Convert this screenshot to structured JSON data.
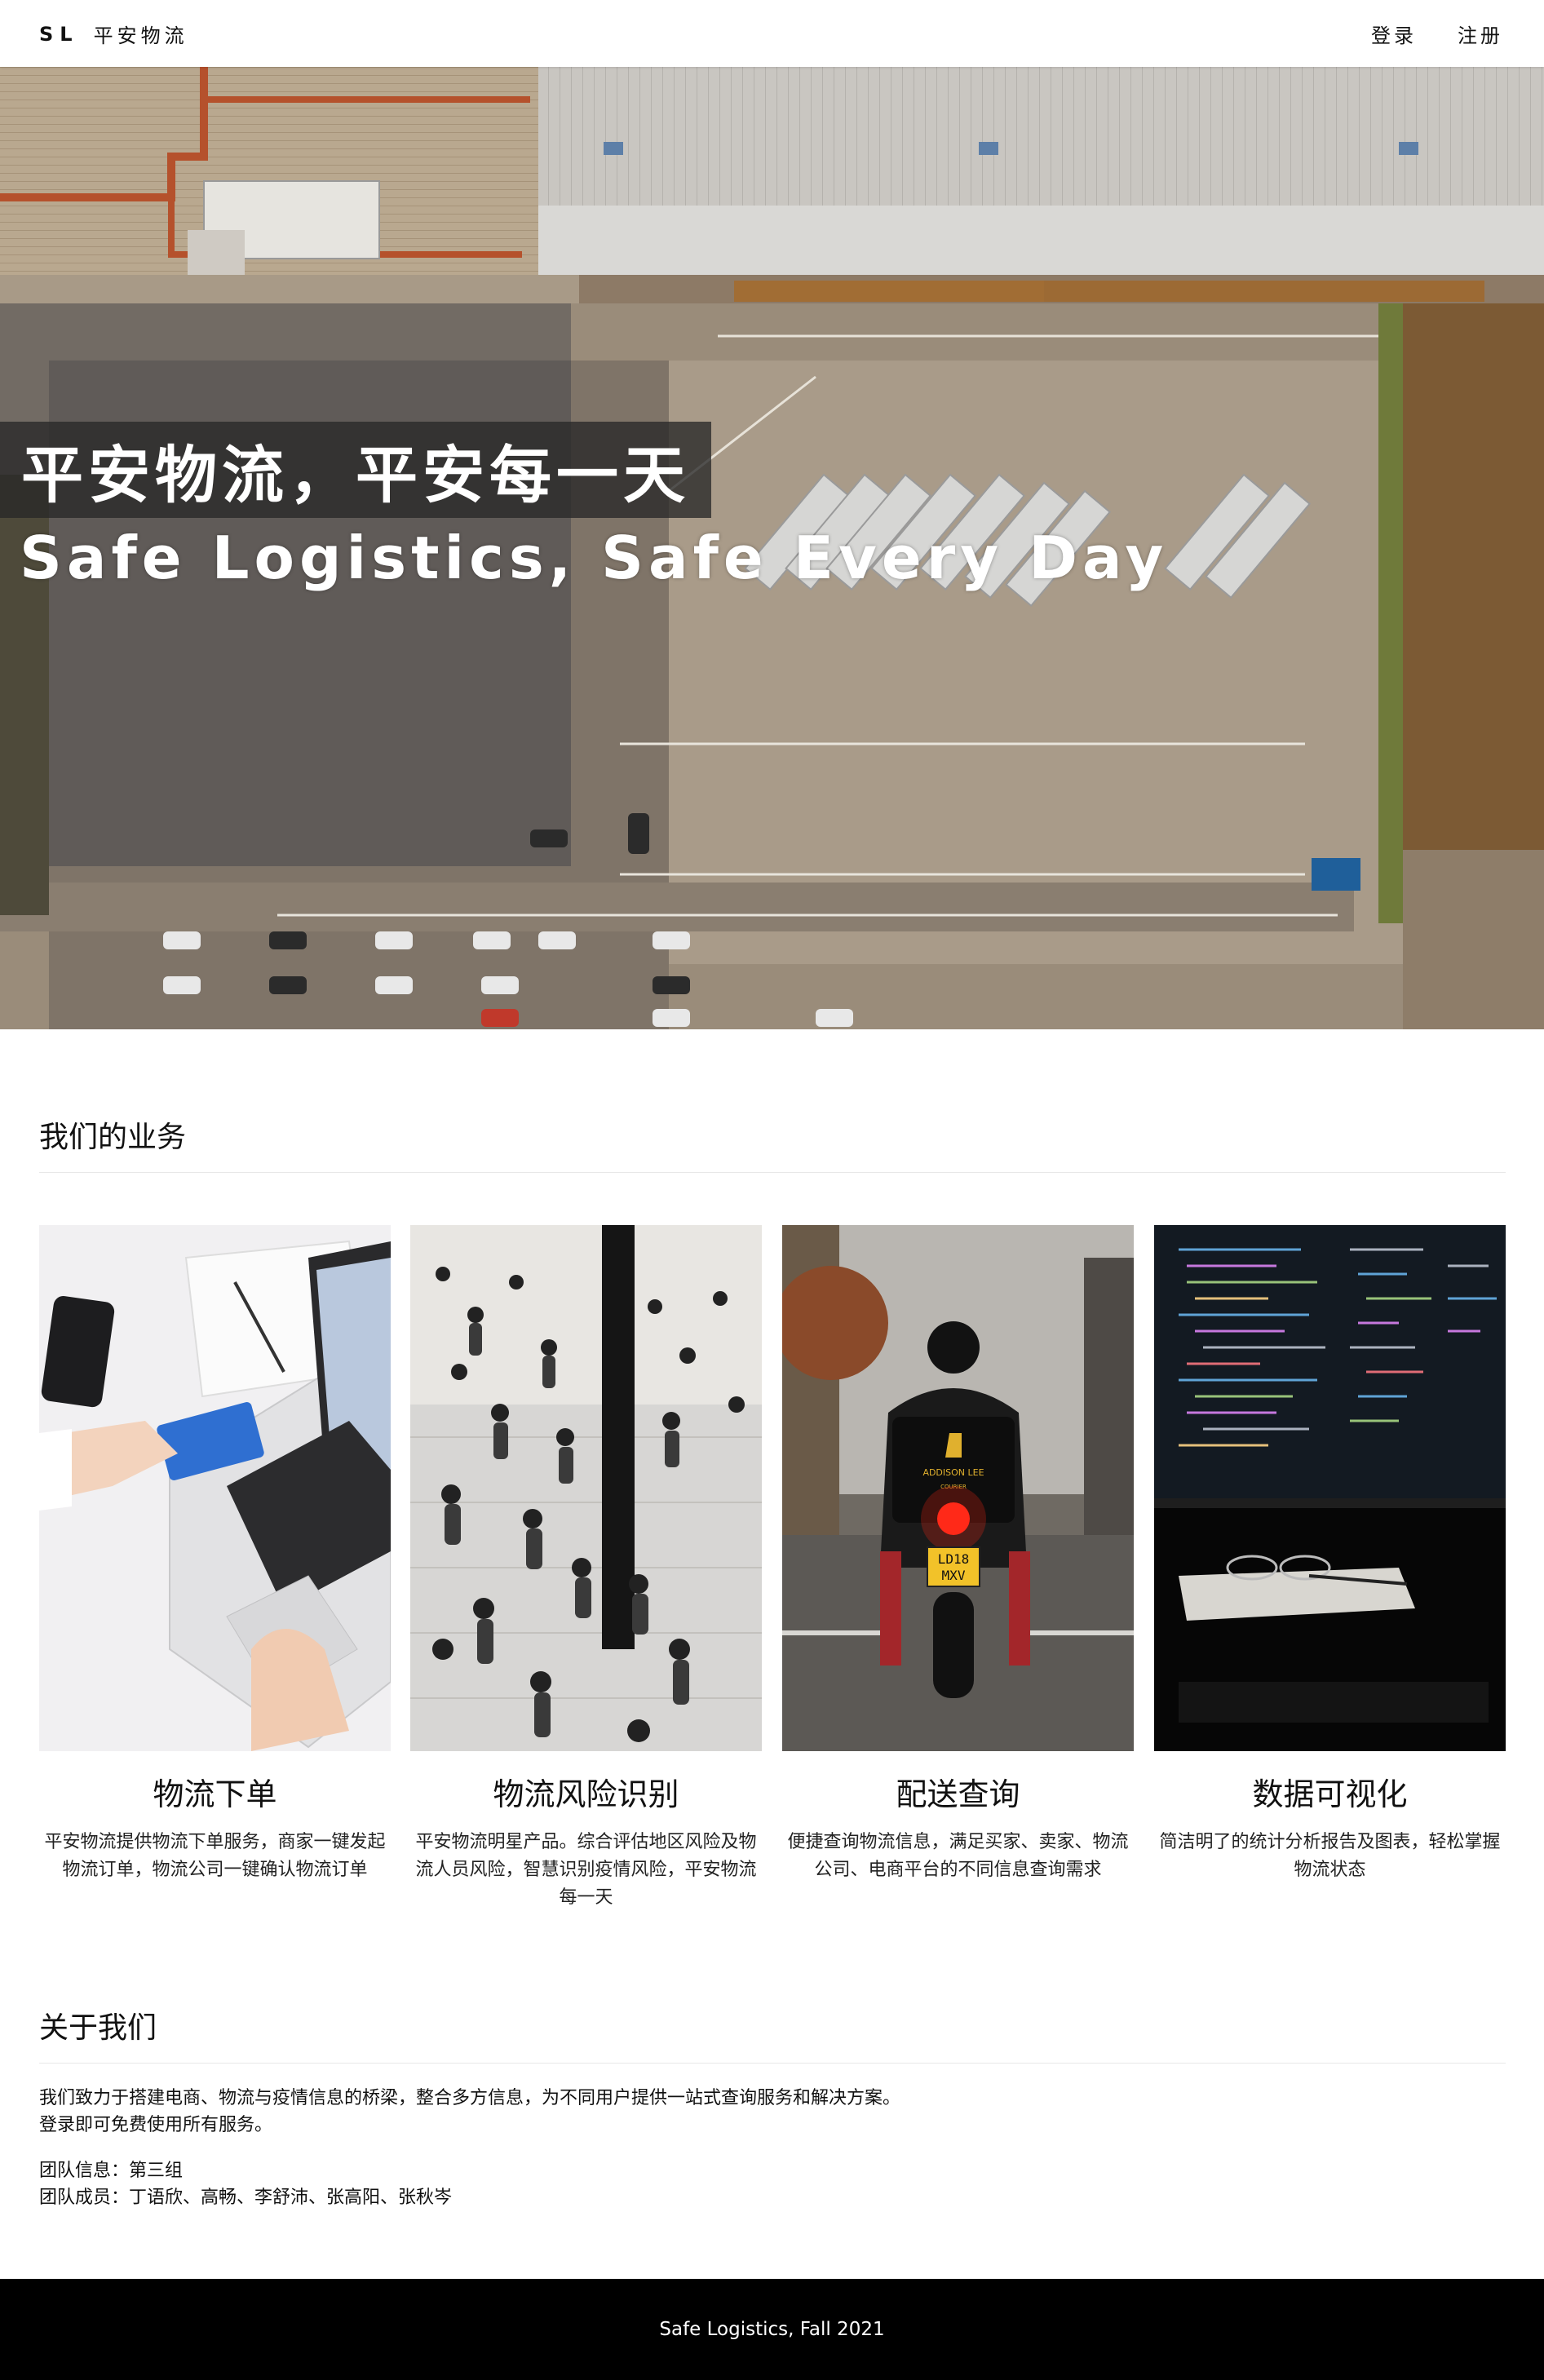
{
  "header": {
    "brand_abbr": "SL",
    "brand_name": "平安物流",
    "login_label": "登录",
    "register_label": "注册"
  },
  "hero": {
    "title": "平安物流，平安每一天",
    "subtitle": "Safe Logistics, Safe Every Day"
  },
  "services": {
    "heading": "我们的业务",
    "cards": [
      {
        "title": "物流下单",
        "desc": "平安物流提供物流下单服务，商家一键发起物流订单，物流公司一键确认物流订单"
      },
      {
        "title": "物流风险识别",
        "desc": "平安物流明星产品。综合评估地区风险及物流人员风险，智慧识别疫情风险，平安物流每一天"
      },
      {
        "title": "配送查询",
        "desc": "便捷查询物流信息，满足买家、卖家、物流公司、电商平台的不同信息查询需求"
      },
      {
        "title": "数据可视化",
        "desc": "简洁明了的统计分析报告及图表，轻松掌握物流状态"
      }
    ],
    "courier_bag_text": "ADDISON LEE",
    "courier_bag_sub": "COURIER",
    "plate_line1": "LD18",
    "plate_line2": "MXV"
  },
  "about": {
    "heading": "关于我们",
    "line1": "我们致力于搭建电商、物流与疫情信息的桥梁，整合多方信息，为不同用户提供一站式查询服务和解决方案。",
    "line2": "登录即可免费使用所有服务。",
    "team_info": "团队信息：第三组",
    "team_members": "团队成员：丁语欣、高畅、李舒沛、张高阳、张秋岑"
  },
  "footer": {
    "text": "Safe Logistics, Fall 2021"
  }
}
